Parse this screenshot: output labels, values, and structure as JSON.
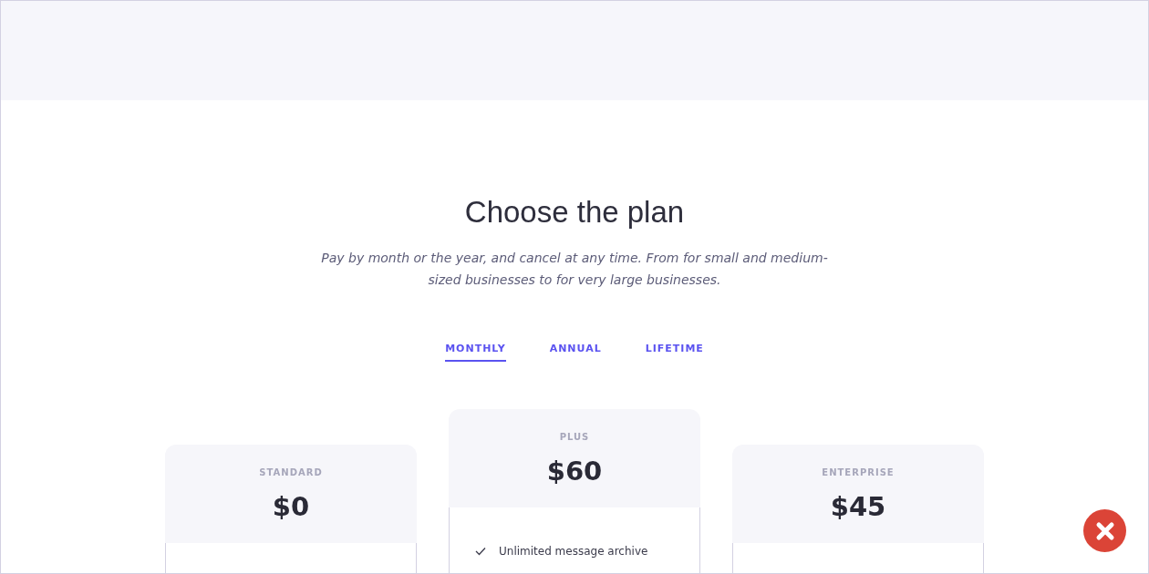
{
  "heading": "Choose the plan",
  "subtitle": "Pay by month or the year, and cancel at any time. From for small and medium-sized businesses to for very large businesses.",
  "tabs": [
    {
      "label": "MONTHLY",
      "selected": true
    },
    {
      "label": "ANNUAL",
      "selected": false
    },
    {
      "label": "LIFETIME",
      "selected": false
    }
  ],
  "plans": [
    {
      "name": "STANDARD",
      "price": "$0"
    },
    {
      "name": "PLUS",
      "price": "$60",
      "features": [
        "Unlimited message archive"
      ]
    },
    {
      "name": "ENTERPRISE",
      "price": "$45"
    }
  ]
}
